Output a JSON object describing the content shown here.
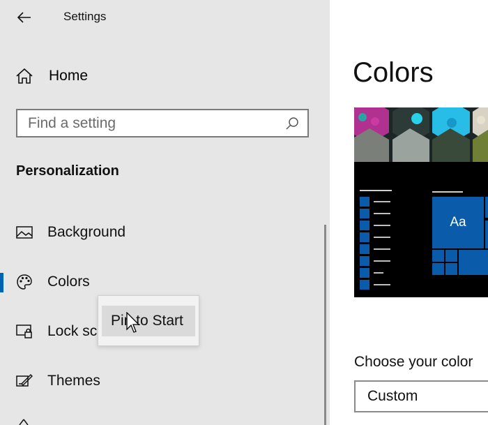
{
  "window": {
    "title": "Settings"
  },
  "sidebar": {
    "home_label": "Home",
    "search": {
      "placeholder": "Find a setting"
    },
    "section_heading": "Personalization",
    "items": [
      {
        "label": "Background",
        "icon": "picture-icon"
      },
      {
        "label": "Colors",
        "icon": "palette-icon",
        "selected": true
      },
      {
        "label": "Lock sc",
        "icon": "lock-screen-icon"
      },
      {
        "label": "Themes",
        "icon": "themes-icon"
      }
    ]
  },
  "context_menu": {
    "item_label": "Pin to Start"
  },
  "main": {
    "title": "Colors",
    "preview": {
      "tile_label": "Aa"
    },
    "choose_color_label": "Choose your color",
    "color_select_value": "Custom"
  },
  "colors": {
    "accent": "#0063b1",
    "sidebar_bg": "#e6e6e6",
    "tile_blue": "#0a5cab"
  }
}
